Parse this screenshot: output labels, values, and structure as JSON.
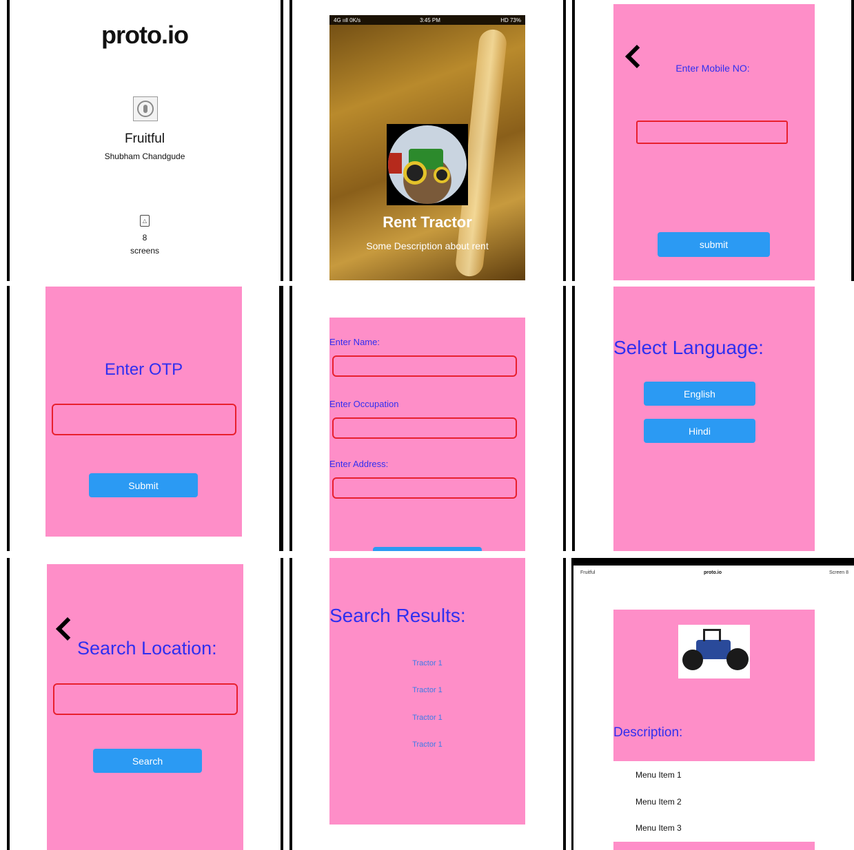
{
  "p1": {
    "logo": "proto.io",
    "app_name": "Fruitful",
    "author": "Shubham Chandgude",
    "screens_count": "8",
    "screens_label": "screens"
  },
  "p2": {
    "status_left": "4G ııll 0K/s",
    "status_time": "3:45 PM",
    "status_right": "HD 73%",
    "title": "Rent Tractor",
    "subtitle": "Some Description about rent"
  },
  "p3": {
    "label": "Enter Mobile NO:",
    "submit": "submit"
  },
  "p4": {
    "title": "Enter OTP",
    "submit": "Submit"
  },
  "p5": {
    "name_label": "Enter Name:",
    "occupation_label": "Enter Occupation",
    "address_label": "Enter Address:"
  },
  "p6": {
    "title": "Select Language:",
    "english": "English",
    "hindi": "Hindi"
  },
  "p7": {
    "title": "Search Location:",
    "search": "Search"
  },
  "p8": {
    "title": "Search Results:",
    "results": [
      "Tractor 1",
      "Tractor 1",
      "Tractor 1",
      "Tractor 1"
    ]
  },
  "p9": {
    "header_left": "Fruitful",
    "header_center": "proto.io",
    "header_right": "Screen 8",
    "description": "Description:",
    "menu": [
      "Menu Item 1",
      "Menu Item 2",
      "Menu Item 3"
    ]
  },
  "colors": {
    "pink": "#fe8ec8",
    "button_blue": "#2b9af3",
    "text_blue": "#2f2ff0",
    "field_red": "#e8202e"
  }
}
